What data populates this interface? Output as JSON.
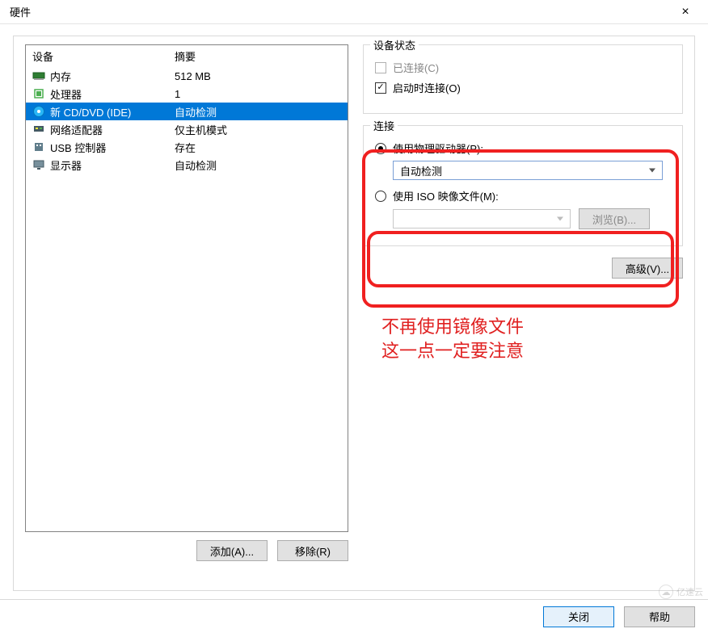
{
  "window": {
    "title": "硬件",
    "close_icon": "×"
  },
  "left": {
    "header_device": "设备",
    "header_summary": "摘要",
    "rows": [
      {
        "icon": "memory-icon",
        "name": "内存",
        "summary": "512 MB",
        "selected": false
      },
      {
        "icon": "cpu-icon",
        "name": "处理器",
        "summary": "1",
        "selected": false
      },
      {
        "icon": "cd-icon",
        "name": "新 CD/DVD (IDE)",
        "summary": "自动检测",
        "selected": true
      },
      {
        "icon": "network-icon",
        "name": "网络适配器",
        "summary": "仅主机模式",
        "selected": false
      },
      {
        "icon": "usb-icon",
        "name": "USB 控制器",
        "summary": "存在",
        "selected": false
      },
      {
        "icon": "display-icon",
        "name": "显示器",
        "summary": "自动检测",
        "selected": false
      }
    ],
    "add_button": "添加(A)...",
    "remove_button": "移除(R)"
  },
  "right": {
    "device_state": {
      "legend": "设备状态",
      "connected_label": "已连接(C)",
      "connected_checked": false,
      "connected_enabled": false,
      "connect_on_poweron_label": "启动时连接(O)",
      "connect_on_poweron_checked": true
    },
    "connection": {
      "legend": "连接",
      "physical_label": "使用物理驱动器(P):",
      "physical_selected": true,
      "physical_drive_value": "自动检测",
      "iso_label": "使用 ISO 映像文件(M):",
      "iso_selected": false,
      "iso_value": "",
      "browse_button": "浏览(B)..."
    },
    "advanced_button": "高级(V)..."
  },
  "annotation": {
    "line1": "不再使用镜像文件",
    "line2": "这一点一定要注意"
  },
  "bottom": {
    "close_button": "关闭",
    "help_button": "帮助"
  },
  "watermark": "亿速云"
}
